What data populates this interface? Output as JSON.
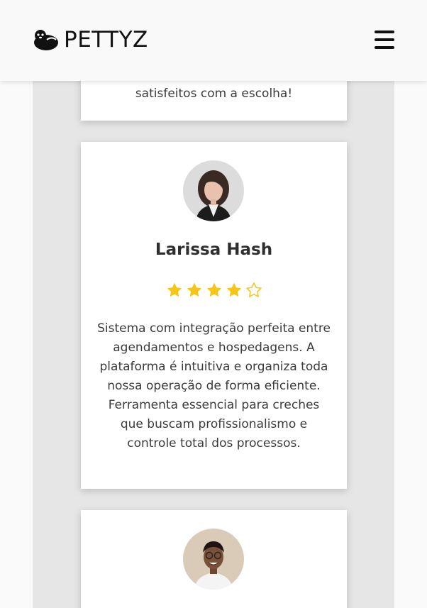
{
  "brand": {
    "name": "PETTYZ"
  },
  "header": {
    "menu_icon": "hamburger-menu-icon"
  },
  "testimonials": [
    {
      "text": "satisfeitos com a escolha!"
    },
    {
      "name": "Larissa Hash",
      "rating": 4,
      "rating_max": 5,
      "text": "Sistema com integração perfeita entre agendamentos e hospedagens. A plataforma é intuitiva e organiza toda nossa operação de forma eficiente. Ferramenta essencial para creches que buscam profissionalismo e controle total dos processos."
    },
    {
      "name": "",
      "text": ""
    }
  ],
  "colors": {
    "star_filled": "#f5c518",
    "page_bg": "#e6e6e6",
    "card_bg": "#ffffff",
    "header_bg": "#f9f9f9"
  }
}
